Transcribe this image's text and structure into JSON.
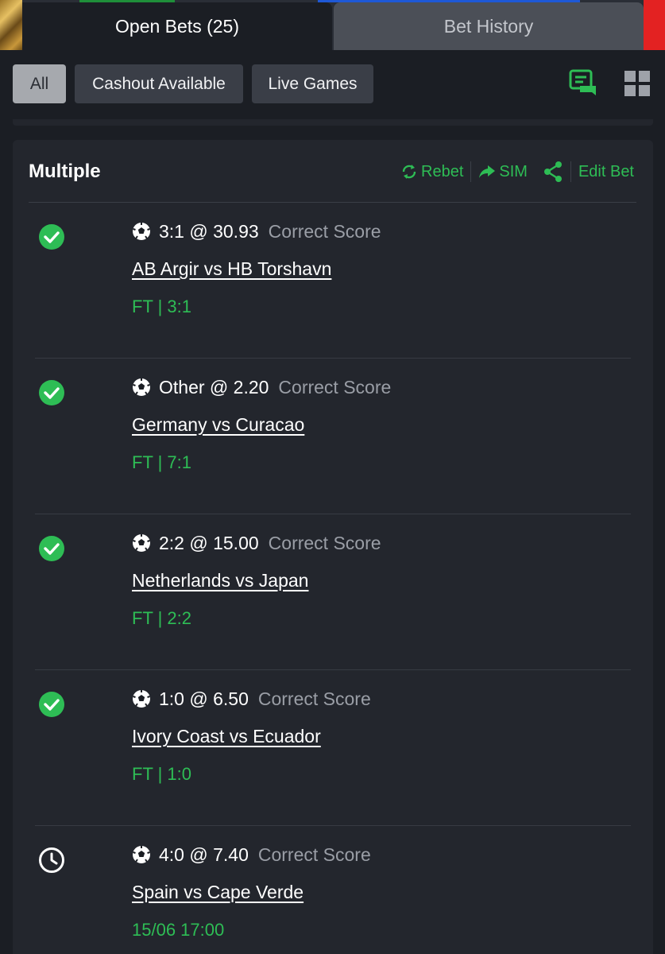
{
  "colors": {
    "accent_green": "#2ebd55",
    "background": "#1b1e24",
    "card": "#23262d",
    "muted_text": "#9a9ea6"
  },
  "tabs": [
    {
      "label": "Open Bets (25)",
      "active": true
    },
    {
      "label": "Bet History",
      "active": false
    }
  ],
  "filters": [
    {
      "label": "All",
      "selected": true
    },
    {
      "label": "Cashout Available",
      "selected": false
    },
    {
      "label": "Live Games",
      "selected": false
    }
  ],
  "toolbar_icons": [
    "chat-icon",
    "grid-view-icon"
  ],
  "bet": {
    "title": "Multiple",
    "actions": [
      {
        "label": "Rebet",
        "icon": "rebet-icon"
      },
      {
        "label": "SIM",
        "icon": "share-arrow-icon"
      },
      {
        "label": "",
        "icon": "share-icon"
      },
      {
        "label": "Edit Bet",
        "icon": ""
      }
    ],
    "legs": [
      {
        "status": "won",
        "status_icon": "check-circle-icon",
        "pick": "3:1 @ 30.93",
        "market": "Correct Score",
        "match": "AB Argir vs HB Torshavn",
        "result": "FT | 3:1"
      },
      {
        "status": "won",
        "status_icon": "check-circle-icon",
        "pick": "Other @ 2.20",
        "market": "Correct Score",
        "match": "Germany vs Curacao",
        "result": "FT | 7:1"
      },
      {
        "status": "won",
        "status_icon": "check-circle-icon",
        "pick": "2:2 @ 15.00",
        "market": "Correct Score",
        "match": "Netherlands vs Japan",
        "result": "FT | 2:2"
      },
      {
        "status": "won",
        "status_icon": "check-circle-icon",
        "pick": "1:0 @ 6.50",
        "market": "Correct Score",
        "match": "Ivory Coast vs Ecuador",
        "result": "FT | 1:0"
      },
      {
        "status": "pending",
        "status_icon": "clock-icon",
        "pick": "4:0 @ 7.40",
        "market": "Correct Score",
        "match": "Spain vs Cape Verde",
        "result": "15/06 17:00"
      }
    ]
  }
}
